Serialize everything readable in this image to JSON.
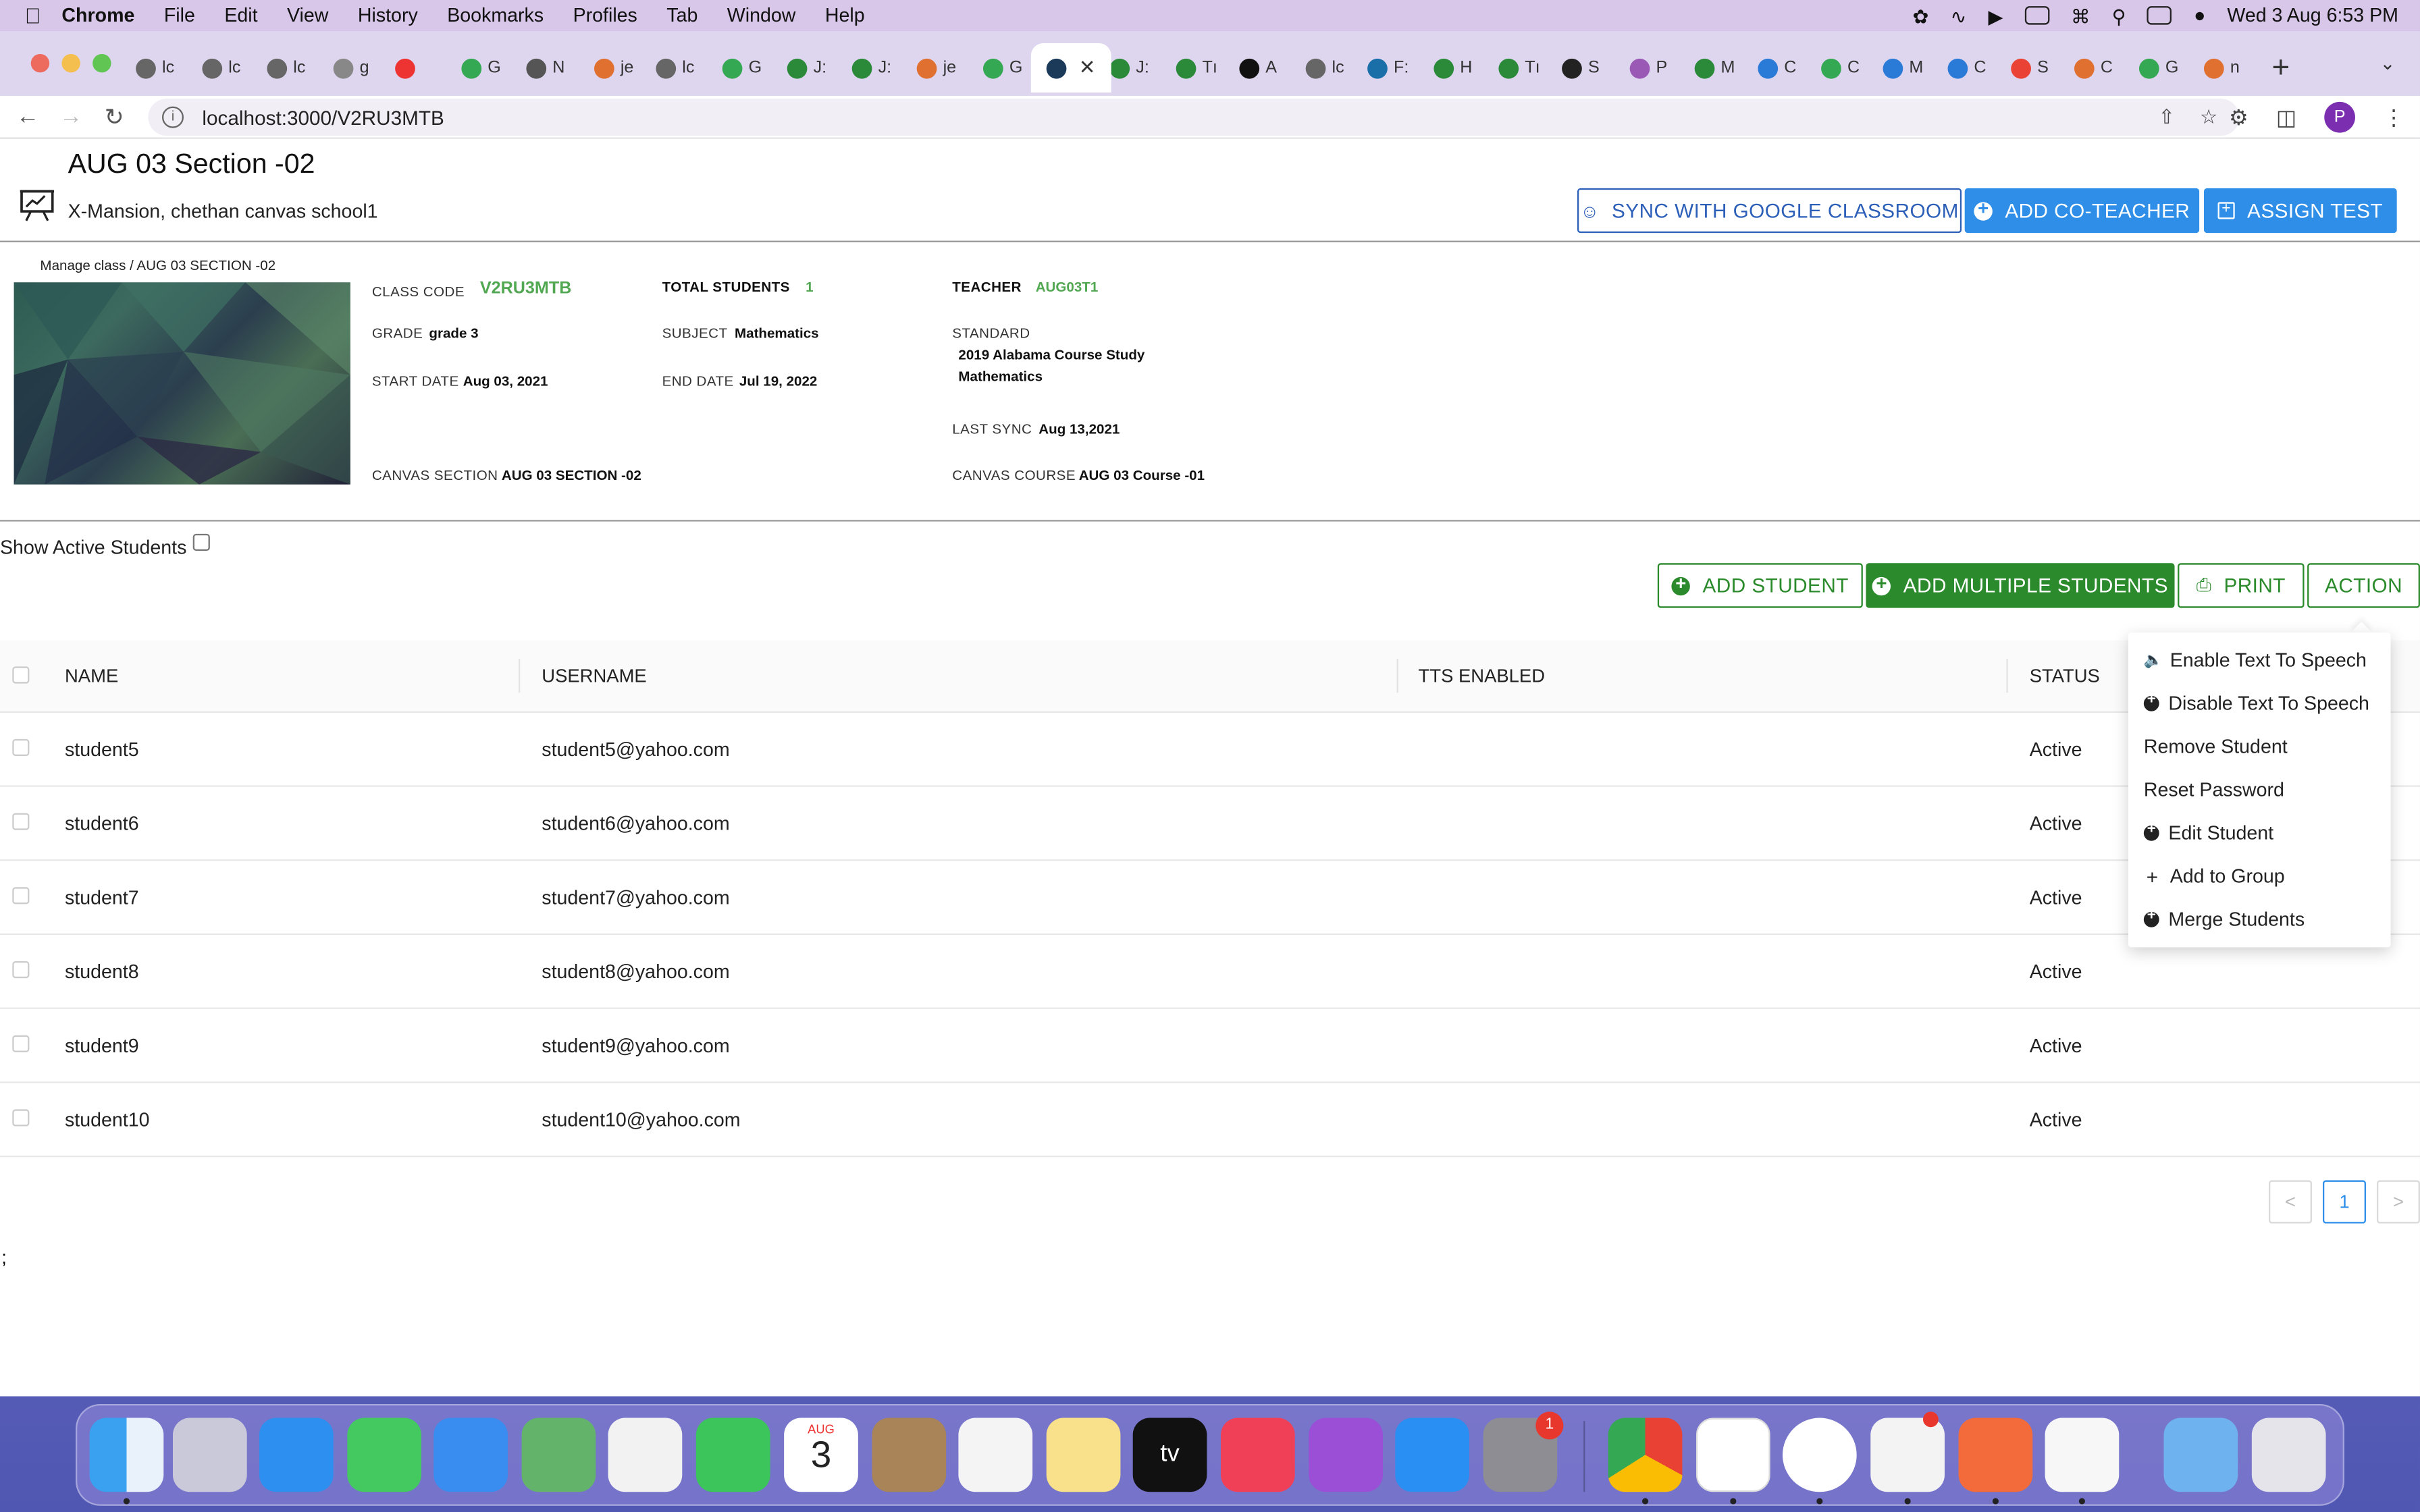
{
  "menubar": {
    "app": "Chrome",
    "items": [
      "File",
      "Edit",
      "View",
      "History",
      "Bookmarks",
      "Profiles",
      "Tab",
      "Window",
      "Help"
    ],
    "datetime": "Wed 3 Aug  6:53 PM"
  },
  "tabs": [
    "lc",
    "lc",
    "lc",
    "g",
    "",
    "G",
    "N",
    "je",
    "lc",
    "G",
    "J:",
    "J:",
    "je",
    "G",
    "",
    "J:",
    "Tı",
    "A",
    "lc",
    "F:",
    "H",
    "Tı",
    "S",
    "P",
    "M",
    "C",
    "C",
    "M",
    "C",
    "S",
    "C",
    "G",
    "n"
  ],
  "browser": {
    "url": "localhost:3000/V2RU3MTB",
    "profile_initial": "P"
  },
  "header": {
    "title": "AUG 03 Section -02",
    "school": "X-Mansion, chethan canvas school1",
    "sync_button": "SYNC WITH GOOGLE CLASSROOM",
    "coteacher_button": "ADD CO-TEACHER",
    "assign_button": "ASSIGN TEST"
  },
  "breadcrumb": "Manage class / AUG 03 SECTION -02",
  "class_info": {
    "class_code_label": "CLASS CODE",
    "class_code": "V2RU3MTB",
    "total_students_label": "TOTAL STUDENTS",
    "total_students": "1",
    "teacher_label": "TEACHER",
    "teacher": "AUG03T1",
    "grade_label": "GRADE",
    "grade": "grade 3",
    "subject_label": "SUBJECT",
    "subject": "Mathematics",
    "standard_label": "STANDARD",
    "standard_line1": "2019 Alabama Course Study",
    "standard_line2": "Mathematics",
    "start_date_label": "START DATE",
    "start_date": "Aug 03, 2021",
    "end_date_label": "END DATE",
    "end_date": "Jul 19, 2022",
    "last_sync_label": "LAST SYNC",
    "last_sync": "Aug 13,2021",
    "canvas_section_label": "CANVAS SECTION",
    "canvas_section": "AUG 03 SECTION -02",
    "canvas_course_label": "CANVAS COURSE",
    "canvas_course": "AUG 03 Course -01"
  },
  "filters": {
    "show_active": "Show Active Students"
  },
  "actions": {
    "add_student": "ADD STUDENT",
    "add_multiple": "ADD MULTIPLE STUDENTS",
    "print": "PRINT",
    "action": "ACTION"
  },
  "table": {
    "columns": [
      "NAME",
      "USERNAME",
      "TTS ENABLED",
      "STATUS"
    ],
    "rows": [
      {
        "name": "student5",
        "username": "student5@yahoo.com",
        "tts": "",
        "status": "Active"
      },
      {
        "name": "student6",
        "username": "student6@yahoo.com",
        "tts": "",
        "status": "Active"
      },
      {
        "name": "student7",
        "username": "student7@yahoo.com",
        "tts": "",
        "status": "Active"
      },
      {
        "name": "student8",
        "username": "student8@yahoo.com",
        "tts": "",
        "status": "Active"
      },
      {
        "name": "student9",
        "username": "student9@yahoo.com",
        "tts": "",
        "status": "Active"
      },
      {
        "name": "student10",
        "username": "student10@yahoo.com",
        "tts": "",
        "status": "Active"
      }
    ]
  },
  "pagination": {
    "prev": "<",
    "current": "1",
    "next": ">"
  },
  "stray_text": ";",
  "action_menu": [
    {
      "label": "Enable Text To Speech",
      "icon": "speaker-icon"
    },
    {
      "label": "Disable Text To Speech",
      "icon": "plus-circle-icon"
    },
    {
      "label": "Remove Student",
      "icon": ""
    },
    {
      "label": "Reset Password",
      "icon": ""
    },
    {
      "label": "Edit Student",
      "icon": "plus-circle-icon"
    },
    {
      "label": "Add to Group",
      "icon": "plus-icon"
    },
    {
      "label": "Merge Students",
      "icon": "plus-circle-icon"
    }
  ],
  "dock": {
    "calendar_month": "AUG",
    "calendar_day": "3",
    "settings_badge": "1"
  },
  "colors": {
    "primary": "#2f8fe8",
    "green": "#2b8a2b",
    "code_green": "#52a852"
  }
}
